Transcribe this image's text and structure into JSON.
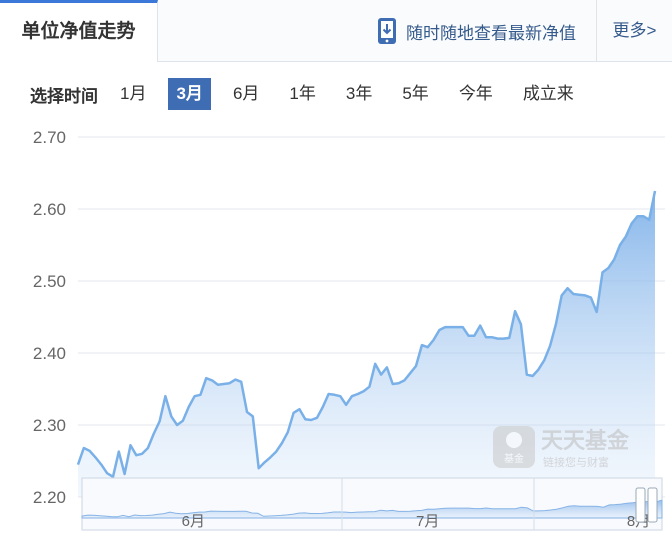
{
  "header": {
    "title": "单位净值走势",
    "promo_label": "随时随地查看最新净值",
    "more_label": "更多>"
  },
  "range_selector": {
    "label": "选择时间",
    "options": [
      "1月",
      "3月",
      "6月",
      "1年",
      "3年",
      "5年",
      "今年",
      "成立来"
    ],
    "selected": "3月"
  },
  "watermark": {
    "brand": "天天基金",
    "slogan": "链接您与财富",
    "logo_text": "基金"
  },
  "chart_data": {
    "type": "area",
    "ylim": [
      2.2,
      2.7
    ],
    "yticks": [
      "2.70",
      "2.60",
      "2.50",
      "2.40",
      "2.30",
      "2.20"
    ],
    "x_labels": [
      "6月",
      "7月",
      "8月"
    ],
    "x_label_index": [
      19,
      59,
      95
    ],
    "series_color": "#7ab0e8",
    "values": [
      2.245,
      2.268,
      2.264,
      2.255,
      2.245,
      2.233,
      2.228,
      2.263,
      2.232,
      2.272,
      2.258,
      2.26,
      2.268,
      2.288,
      2.305,
      2.34,
      2.312,
      2.3,
      2.306,
      2.325,
      2.34,
      2.342,
      2.365,
      2.362,
      2.356,
      2.357,
      2.358,
      2.363,
      2.36,
      2.318,
      2.312,
      2.24,
      2.248,
      2.255,
      2.263,
      2.275,
      2.29,
      2.317,
      2.322,
      2.308,
      2.307,
      2.31,
      2.325,
      2.343,
      2.342,
      2.34,
      2.328,
      2.34,
      2.343,
      2.347,
      2.353,
      2.385,
      2.37,
      2.38,
      2.357,
      2.358,
      2.362,
      2.372,
      2.382,
      2.411,
      2.408,
      2.418,
      2.432,
      2.436,
      2.436,
      2.436,
      2.436,
      2.424,
      2.424,
      2.438,
      2.422,
      2.422,
      2.42,
      2.42,
      2.421,
      2.458,
      2.44,
      2.37,
      2.368,
      2.377,
      2.39,
      2.41,
      2.44,
      2.48,
      2.49,
      2.482,
      2.481,
      2.48,
      2.477,
      2.457,
      2.512,
      2.518,
      2.53,
      2.55,
      2.562,
      2.58,
      2.59,
      2.59,
      2.585,
      2.625
    ]
  }
}
